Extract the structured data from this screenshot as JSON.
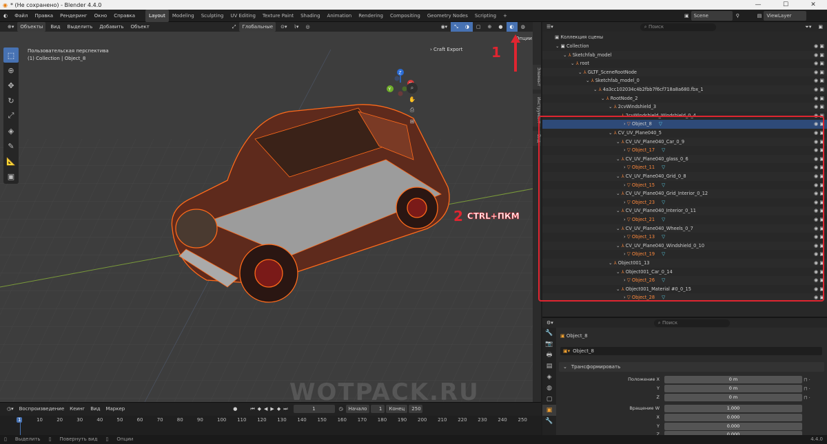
{
  "window": {
    "title": "* (Не сохранено) - Blender 4.4.0"
  },
  "menu": {
    "items": [
      "Файл",
      "Правка",
      "Рендеринг",
      "Окно",
      "Справка"
    ],
    "workspaces": [
      "Layout",
      "Modeling",
      "Sculpting",
      "UV Editing",
      "Texture Paint",
      "Shading",
      "Animation",
      "Rendering",
      "Compositing",
      "Geometry Nodes",
      "Scripting"
    ],
    "plus": "+",
    "scene": "Scene",
    "view_layer": "ViewLayer"
  },
  "viewport": {
    "mode": "Объекты",
    "menus": [
      "Вид",
      "Выделить",
      "Добавить",
      "Объект"
    ],
    "orientation": "Глобальные",
    "perspective_label": "Пользовательская перспектива",
    "collection_label": "(1) Collection | Object_8",
    "craft_export": "Craft Export",
    "options": "Опции",
    "watermark": "WOTPACK.RU",
    "side_tabs": [
      "Элемент",
      "Инструмент",
      "Вид"
    ],
    "annotation_1": "1",
    "annotation_2": "2",
    "annotation_2_text": "CTRL+ПКМ"
  },
  "timeline": {
    "menus": [
      "Воспроизведение",
      "Кеинг",
      "Вид",
      "Маркер"
    ],
    "current_frame": "1",
    "start_label": "Начало",
    "start": "1",
    "end_label": "Конец",
    "end": "250",
    "ticks": [
      "1",
      "10",
      "20",
      "30",
      "40",
      "50",
      "60",
      "70",
      "80",
      "90",
      "100",
      "110",
      "120",
      "130",
      "140",
      "150",
      "160",
      "170",
      "180",
      "190",
      "200",
      "210",
      "220",
      "230",
      "240",
      "250"
    ]
  },
  "status": {
    "select": "Выделить",
    "rotate": "Повернуть вид",
    "options": "Опции",
    "version": "4.4.0"
  },
  "outliner": {
    "search_placeholder": "Поиск",
    "root": "Коллекция сцены",
    "rows": [
      {
        "label": "Collection",
        "indent": 1
      },
      {
        "label": "Sketchfab_model",
        "indent": 2
      },
      {
        "label": "root",
        "indent": 3
      },
      {
        "label": "GLTF_SceneRootNode",
        "indent": 4
      },
      {
        "label": "Sketchfab_model_0",
        "indent": 5
      },
      {
        "label": "4a3cc102034c4b2fbb7f6cf718a8a680.fbx_1",
        "indent": 6
      },
      {
        "label": "RootNode_2",
        "indent": 7
      },
      {
        "label": "2cvWindshield_3",
        "indent": 8
      },
      {
        "label": "2cvWindshield_Windshield_0_4",
        "indent": 9
      },
      {
        "label": "Object_8",
        "indent": 10,
        "obj": true,
        "sel": true
      },
      {
        "label": "CV_UV_Plane040_5",
        "indent": 8
      },
      {
        "label": "CV_UV_Plane040_Car_0_9",
        "indent": 9
      },
      {
        "label": "Object_17",
        "indent": 10,
        "obj": true
      },
      {
        "label": "CV_UV_Plane040_glass_0_6",
        "indent": 9
      },
      {
        "label": "Object_11",
        "indent": 10,
        "obj": true
      },
      {
        "label": "CV_UV_Plane040_Grid_0_8",
        "indent": 9
      },
      {
        "label": "Object_15",
        "indent": 10,
        "obj": true
      },
      {
        "label": "CV_UV_Plane040_Grid_Interior_0_12",
        "indent": 9
      },
      {
        "label": "Object_23",
        "indent": 10,
        "obj": true
      },
      {
        "label": "CV_UV_Plane040_Interior_0_11",
        "indent": 9
      },
      {
        "label": "Object_21",
        "indent": 10,
        "obj": true
      },
      {
        "label": "CV_UV_Plane040_Wheels_0_7",
        "indent": 9
      },
      {
        "label": "Object_13",
        "indent": 10,
        "obj": true
      },
      {
        "label": "CV_UV_Plane040_Windshield_0_10",
        "indent": 9
      },
      {
        "label": "Object_19",
        "indent": 10,
        "obj": true
      },
      {
        "label": "Object001_13",
        "indent": 8
      },
      {
        "label": "Object001_Car_0_14",
        "indent": 9
      },
      {
        "label": "Object_26",
        "indent": 10,
        "obj": true
      },
      {
        "label": "Object001_Material #0_0_15",
        "indent": 9
      },
      {
        "label": "Object_28",
        "indent": 10,
        "obj": true
      }
    ]
  },
  "properties": {
    "search_placeholder": "Поиск",
    "object_name": "Object_8",
    "data_name": "Object_8",
    "panel": "Трансформировать",
    "location_label": "Положение X",
    "rotation_label": "Вращение W",
    "axes": [
      "Y",
      "Z"
    ],
    "rot_axes": [
      "X",
      "Y",
      "Z"
    ],
    "location": [
      "0 m",
      "0 m",
      "0 m"
    ],
    "rotation": [
      "1.000",
      "0.000",
      "0.000",
      "0.000"
    ]
  }
}
